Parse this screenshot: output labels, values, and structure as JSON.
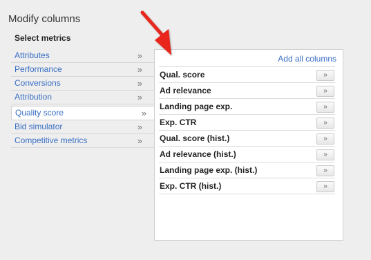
{
  "dialog": {
    "title": "Modify columns",
    "subtitle": "Select metrics"
  },
  "categories": [
    {
      "label": "Attributes",
      "arrows": "»"
    },
    {
      "label": "Performance",
      "arrows": "»"
    },
    {
      "label": "Conversions",
      "arrows": "»"
    },
    {
      "label": "Attribution",
      "arrows": "»"
    },
    {
      "label": "Quality score",
      "arrows": "»",
      "selected": true
    },
    {
      "label": "Bid simulator",
      "arrows": "»"
    },
    {
      "label": "Competitive metrics",
      "arrows": "»"
    }
  ],
  "panel": {
    "add_all_label": "Add all columns",
    "metrics": [
      {
        "label": "Qual. score",
        "button": "»"
      },
      {
        "label": "Ad relevance",
        "button": "»"
      },
      {
        "label": "Landing page exp.",
        "button": "»"
      },
      {
        "label": "Exp. CTR",
        "button": "»"
      },
      {
        "label": "Qual. score (hist.)",
        "button": "»"
      },
      {
        "label": "Ad relevance (hist.)",
        "button": "»"
      },
      {
        "label": "Landing page exp. (hist.)",
        "button": "»"
      },
      {
        "label": "Exp. CTR (hist.)",
        "button": "»"
      }
    ]
  },
  "colors": {
    "link": "#3a6fc4",
    "annotation_arrow": "#e8261c"
  }
}
